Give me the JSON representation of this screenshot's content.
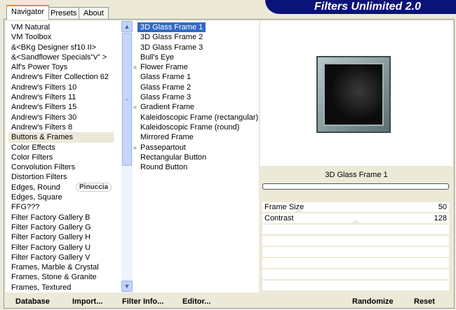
{
  "banner": {
    "title": "Filters Unlimited 2.0"
  },
  "tabs": [
    {
      "label": "Navigator",
      "active": true
    },
    {
      "label": "Presets"
    },
    {
      "label": "About"
    }
  ],
  "categories": [
    "VM Natural",
    "VM Toolbox",
    "&<BKg Designer sf10 II>",
    "&<Sandflower Specials\"v\" >",
    "Alf's Power Toys",
    "Andrew's Filter Collection 62",
    "Andrew's Filters 10",
    "Andrew's Filters 11",
    "Andrew's Filters 15",
    "Andrew's Filters 30",
    "Andrew's Filters 8",
    "Buttons & Frames",
    "Color Effects",
    "Color Filters",
    "Convolution Filters",
    "Distortion Filters",
    "Edges, Round",
    "Edges, Square",
    "FFG???",
    "Filter Factory Gallery B",
    "Filter Factory Gallery G",
    "Filter Factory Gallery H",
    "Filter Factory Gallery U",
    "Filter Factory Gallery V",
    "Frames, Marble & Crystal",
    "Frames, Stone & Granite",
    "Frames, Textured"
  ],
  "selected_category": "Buttons & Frames",
  "filters": [
    {
      "label": "3D Glass Frame 1",
      "selected": true
    },
    {
      "label": "3D Glass Frame 2"
    },
    {
      "label": "3D Glass Frame 3"
    },
    {
      "label": "Bull's Eye"
    },
    {
      "label": "Flower Frame",
      "marked": true
    },
    {
      "label": "Glass Frame 1"
    },
    {
      "label": "Glass Frame 2"
    },
    {
      "label": "Glass Frame 3"
    },
    {
      "label": "Gradient Frame",
      "marked": true
    },
    {
      "label": "Kaleidoscopic Frame (rectangular)"
    },
    {
      "label": "Kaleidoscopic Frame (round)"
    },
    {
      "label": "Mirrored Frame"
    },
    {
      "label": "Passepartout",
      "marked": true
    },
    {
      "label": "Rectangular Button"
    },
    {
      "label": "Round Button"
    }
  ],
  "watermark": "Pinuccia",
  "preview": {
    "filter_name": "3D Glass Frame 1",
    "progress": 0
  },
  "params": [
    {
      "label": "Frame Size",
      "value": "50",
      "level": 0.196
    },
    {
      "label": "Contrast",
      "value": "128",
      "level": 0.5
    }
  ],
  "buttons": {
    "database": "Database",
    "import": "Import...",
    "filter_info": "Filter Info...",
    "editor": "Editor...",
    "randomize": "Randomize",
    "reset": "Reset"
  },
  "colors": {
    "selection": "#316ac5",
    "banner": "#0a1478"
  }
}
